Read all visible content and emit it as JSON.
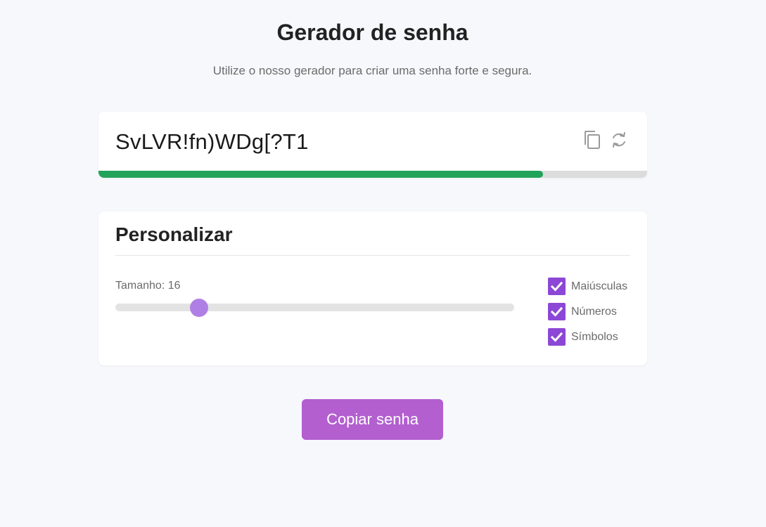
{
  "header": {
    "title": "Gerador de senha",
    "subtitle": "Utilize o nosso gerador para criar uma senha forte e segura."
  },
  "password": {
    "value": "SvLVR!fn)WDg[?T1",
    "strength_fraction": 0.81,
    "strength_color": "#22a35a",
    "copy_icon": "copy-icon",
    "refresh_icon": "refresh-icon"
  },
  "customize": {
    "title": "Personalizar",
    "size_label": "Tamanho: 16",
    "size_value": 16,
    "size_fraction": 0.21,
    "options": [
      {
        "label": "Maiúsculas",
        "checked": true
      },
      {
        "label": "Números",
        "checked": true
      },
      {
        "label": "Símbolos",
        "checked": true
      }
    ]
  },
  "actions": {
    "copy_label": "Copiar senha"
  },
  "colors": {
    "accent": "#8c47d6",
    "button": "#b35fd0",
    "slider_thumb": "#b07fe5",
    "background": "#f7f8fc"
  }
}
